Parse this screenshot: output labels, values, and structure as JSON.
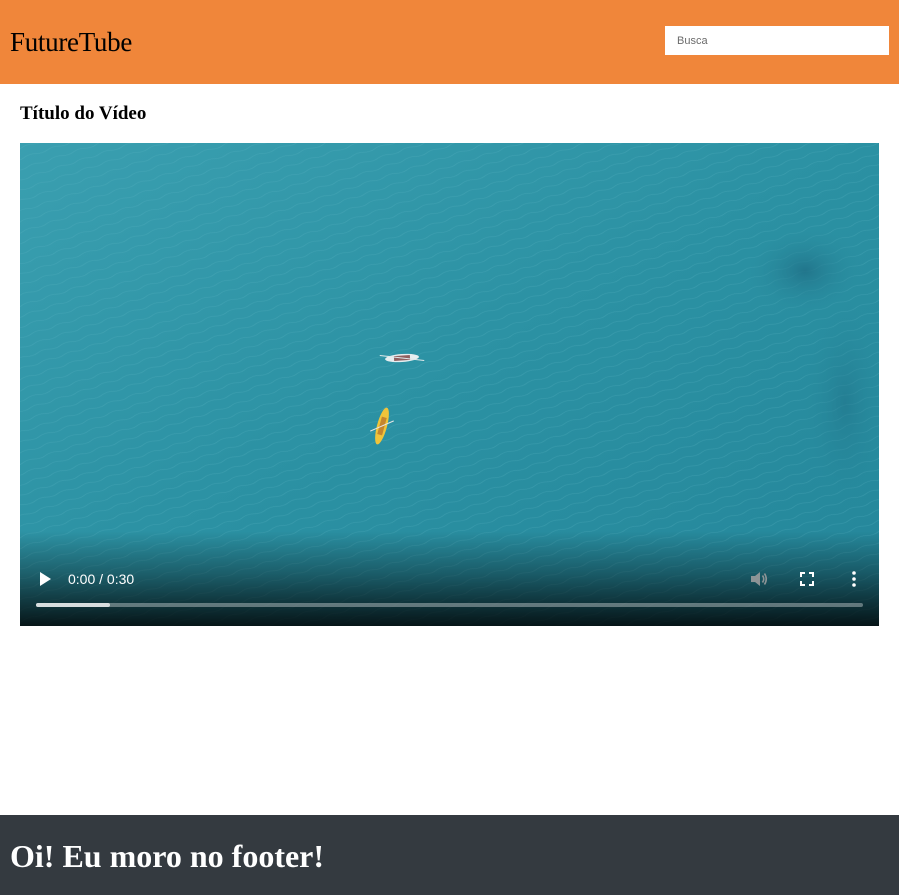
{
  "header": {
    "logo": "FutureTube",
    "search_placeholder": "Busca"
  },
  "main": {
    "video_title": "Título do Vídeo"
  },
  "player": {
    "time": "0:00 / 0:30",
    "buffered_fraction": 0.09,
    "icons": [
      "play-icon",
      "volume-icon",
      "fullscreen-icon",
      "more-options-icon"
    ],
    "water_color": "#2a8fa1"
  },
  "footer": {
    "text": "Oi! Eu moro no footer!"
  },
  "colors": {
    "header_bg": "#f0863a",
    "footer_bg": "#343a40"
  }
}
